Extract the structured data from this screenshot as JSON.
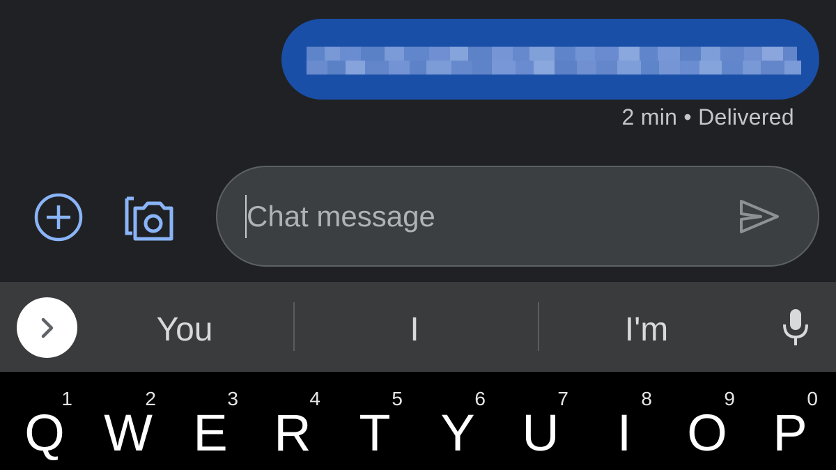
{
  "message": {
    "text": "(pixelated message)",
    "meta": "2 min • Delivered"
  },
  "compose": {
    "placeholder": "Chat message"
  },
  "icons": {
    "add": "add-circle-icon",
    "camera": "camera-gallery-icon",
    "send": "send-icon",
    "expand": "chevron-right-icon",
    "mic": "microphone-icon"
  },
  "suggestions": [
    "You",
    "I",
    "I'm"
  ],
  "keyboard": {
    "row": [
      {
        "letter": "Q",
        "num": "1"
      },
      {
        "letter": "W",
        "num": "2"
      },
      {
        "letter": "E",
        "num": "3"
      },
      {
        "letter": "R",
        "num": "4"
      },
      {
        "letter": "T",
        "num": "5"
      },
      {
        "letter": "Y",
        "num": "6"
      },
      {
        "letter": "U",
        "num": "7"
      },
      {
        "letter": "I",
        "num": "8"
      },
      {
        "letter": "O",
        "num": "9"
      },
      {
        "letter": "P",
        "num": "0"
      }
    ]
  },
  "colors": {
    "background": "#202124",
    "bubble": "#1a4fa8",
    "accent_icon": "#8ab4f8",
    "compose_bg": "#3c3f42",
    "suggest_bar": "#3a3b3d",
    "keyboard_bg": "#000000"
  }
}
